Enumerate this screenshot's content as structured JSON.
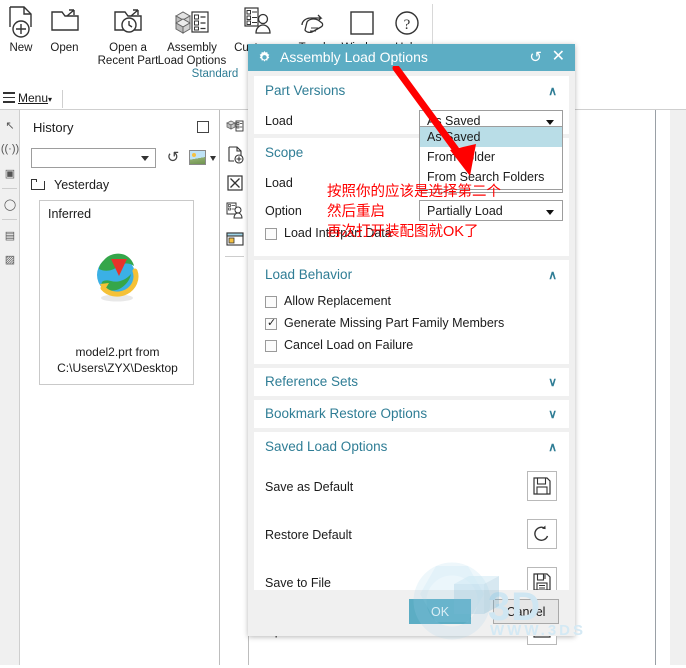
{
  "ribbon": {
    "groups": [
      {
        "label": "New",
        "icon": "new-part-icon",
        "caret": false
      },
      {
        "label": "Open",
        "icon": "open-folder-icon",
        "caret": false
      },
      {
        "label": "Open a\nRecent Part",
        "icon": "open-recent-part-icon",
        "caret": true
      },
      {
        "label": "Assembly\nLoad Options",
        "icon": "assembly-load-options-icon",
        "caret": false
      },
      {
        "label": "Customer\nDe",
        "icon": "customer-defaults-icon",
        "caret": false
      },
      {
        "label": "Touch",
        "icon": "touch-icon",
        "caret": false
      },
      {
        "label": "Window",
        "icon": "window-icon",
        "caret": false
      },
      {
        "label": "Help",
        "icon": "help-icon",
        "caret": false
      }
    ],
    "group_name": "Standard"
  },
  "menubar": {
    "menu_label": "Menu",
    "caret": "▾"
  },
  "history": {
    "title": "History",
    "combo_value": "",
    "group_label": "Yesterday",
    "card_title": "Inferred",
    "file_text": "model2.prt from\nC:\\Users\\ZYX\\Desktop"
  },
  "dialog": {
    "title": "Assembly Load Options",
    "reset_icon": "reset-icon",
    "close_icon": "close-icon",
    "part_versions": {
      "title": "Part Versions",
      "chevron": "∧",
      "load_label": "Load",
      "load_value": "As Saved"
    },
    "dropdown": {
      "options": [
        "As Saved",
        "From Folder",
        "From Search Folders"
      ],
      "selected": "As Saved"
    },
    "scope": {
      "title": "Scope",
      "chevron": "∧",
      "load_label": "Load",
      "load_value": "",
      "option_label": "Option",
      "option_value": "Partially Load",
      "interpart_label": "Load Interpart Data",
      "interpart_checked": false
    },
    "load_behavior": {
      "title": "Load Behavior",
      "chevron": "∧",
      "items": [
        {
          "label": "Allow Replacement",
          "checked": false
        },
        {
          "label": "Generate Missing Part Family Members",
          "checked": true
        },
        {
          "label": "Cancel Load on Failure",
          "checked": false
        }
      ]
    },
    "reference_sets": {
      "title": "Reference Sets",
      "chevron": "∨"
    },
    "bookmark_restore": {
      "title": "Bookmark Restore Options",
      "chevron": "∨"
    },
    "saved_load_options": {
      "title": "Saved Load Options",
      "chevron": "∧",
      "rows": [
        {
          "label": "Save as Default",
          "icon": "floppy-save-icon"
        },
        {
          "label": "Restore Default",
          "icon": "undo-restore-icon"
        },
        {
          "label": "Save to File",
          "icon": "floppy-save-to-file-icon"
        },
        {
          "label": "Open from File",
          "icon": "open-folder-arrow-icon"
        }
      ]
    },
    "footer": {
      "ok_label": "OK",
      "cancel_label": "Cancel"
    }
  },
  "annotations": {
    "chinese_note": "按照你的应该是选择第二个\n然后重启\n再次打开装配图就OK了",
    "arrow_color": "#ff0000",
    "note_color": "#ff0000"
  },
  "watermark": {
    "text": "3D",
    "subtext": "WWW.3DS"
  },
  "colors": {
    "title_bar": "#5cadc4",
    "section_title": "#2f7d95",
    "dropdown_selection": "#b9dde7",
    "dialog_bg": "#f0f0f0"
  }
}
